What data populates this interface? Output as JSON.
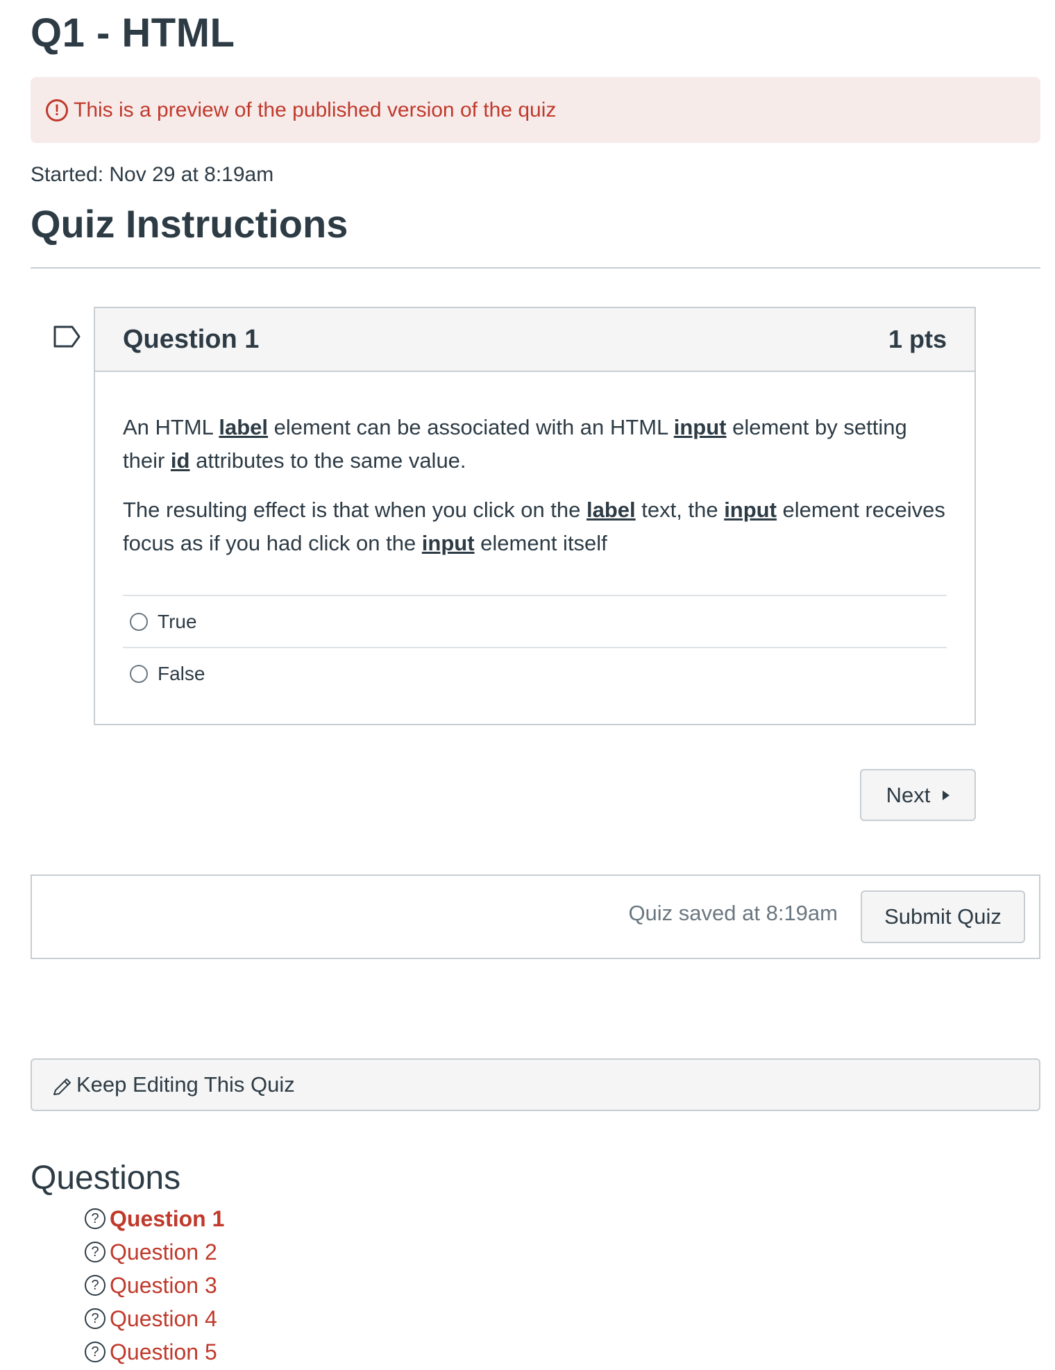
{
  "quiz": {
    "title": "Q1 - HTML",
    "preview_notice": "This is a preview of the published version of the quiz",
    "started": "Started: Nov 29 at 8:19am",
    "instructions_title": "Quiz Instructions"
  },
  "question": {
    "name": "Question 1",
    "points": "1 pts",
    "paragraph1": {
      "t1": "An HTML ",
      "k1": "label",
      "t2": " element can be associated with an HTML ",
      "k2": "input",
      "t3": " element by setting their ",
      "k3": "id",
      "t4": " attributes to the same value."
    },
    "paragraph2": {
      "t1": "The resulting effect is that when you click on the ",
      "k1": "label",
      "t2": " text, the ",
      "k2": "input",
      "t3": " element receives focus as if you had click on the ",
      "k3": "input",
      "t4": " element itself"
    },
    "answers": [
      {
        "label": "True"
      },
      {
        "label": "False"
      }
    ]
  },
  "navigation": {
    "next_label": "Next"
  },
  "submit_bar": {
    "saved_text": "Quiz saved at 8:19am",
    "submit_label": "Submit Quiz"
  },
  "keep_editing_label": "Keep Editing This Quiz",
  "questions_panel": {
    "heading": "Questions",
    "items": [
      {
        "label": "Question 1"
      },
      {
        "label": "Question 2"
      },
      {
        "label": "Question 3"
      },
      {
        "label": "Question 4"
      },
      {
        "label": "Question 5"
      }
    ]
  },
  "icons": {
    "alert": "exclamation-circle-icon",
    "flag": "bookmark-flag-icon",
    "next": "caret-right-icon",
    "edit": "pencil-icon",
    "question_status": "question-circle-icon"
  },
  "colors": {
    "alert_text": "#c0392b",
    "alert_background": "#f7ebea",
    "link": "#c0392b",
    "text": "#2d3b45"
  }
}
